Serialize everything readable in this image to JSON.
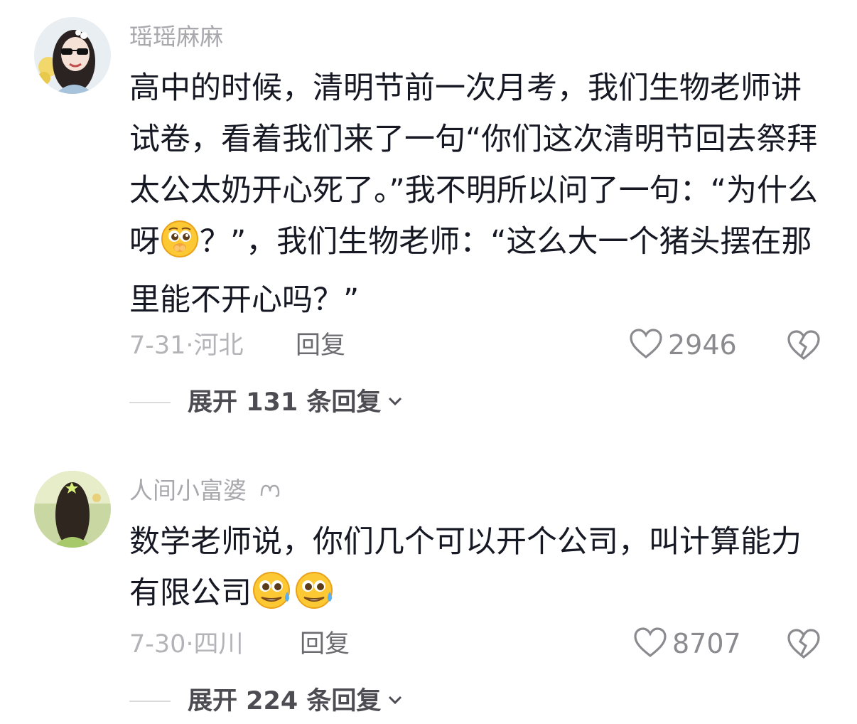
{
  "comments": [
    {
      "username": "瑶瑶麻麻",
      "text_a": "高中的时候，清明节前一次月考，我们生物老师讲试卷，看着我们来了一句“你们这次清明节回去祭拜太公太奶开心死了。”我不明所以问了一句：“为什么呀",
      "text_b": "？”，我们生物老师：“这么大一个猪头摆在那里能不开心吗？”",
      "date_location": "7-31·河北",
      "reply_label": "回复",
      "likes": "2946",
      "expand_label": "展开 131 条回复"
    },
    {
      "username": "人间小富婆",
      "text": "数学老师说，你们几个可以开个公司，叫计算能力有限公司",
      "date_location": "7-30·四川",
      "reply_label": "回复",
      "likes": "8707",
      "expand_label": "展开 224 条回复"
    }
  ],
  "icons": {
    "like": "heart-outline-icon",
    "dislike": "broken-heart-icon",
    "expand": "chevron-down-icon",
    "emoji_1": "pleading-face-emoji",
    "emoji_2": "sweat-smile-face-emoji",
    "username_badge": "squiggle-icon"
  }
}
